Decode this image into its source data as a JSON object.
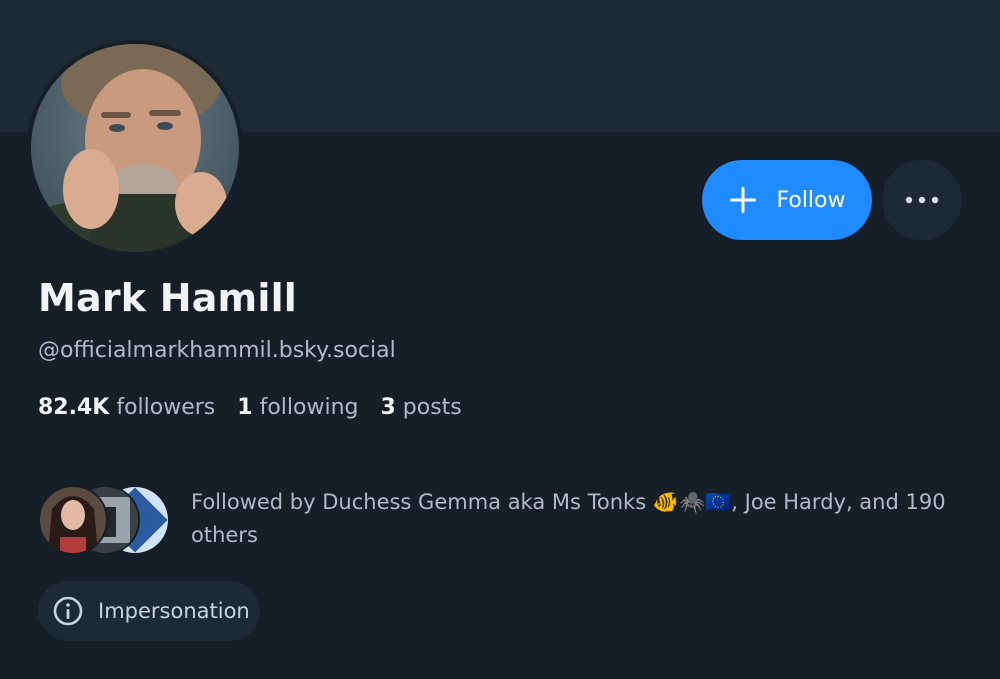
{
  "profile": {
    "display_name": "Mark Hamill",
    "handle": "@officialmarkhammil.bsky.social"
  },
  "actions": {
    "follow_label": "Follow",
    "follow_icon": "plus-icon",
    "more_icon": "ellipsis-icon"
  },
  "stats": {
    "followers_count": "82.4K",
    "followers_label": "followers",
    "following_count": "1",
    "following_label": "following",
    "posts_count": "3",
    "posts_label": "posts"
  },
  "known_followers": {
    "text_lead": "Followed by Duchess Gemma aka Ms Tonks ",
    "emoji": "🐠🕷️🇪🇺",
    "text_tail": ", Joe Hardy, and 190 others"
  },
  "labels": {
    "impersonation": "Impersonation",
    "impersonation_icon": "info-icon"
  },
  "colors": {
    "background": "#161e27",
    "banner": "#1e2936",
    "accent": "#208bfe",
    "muted_text": "#aebbc9"
  }
}
